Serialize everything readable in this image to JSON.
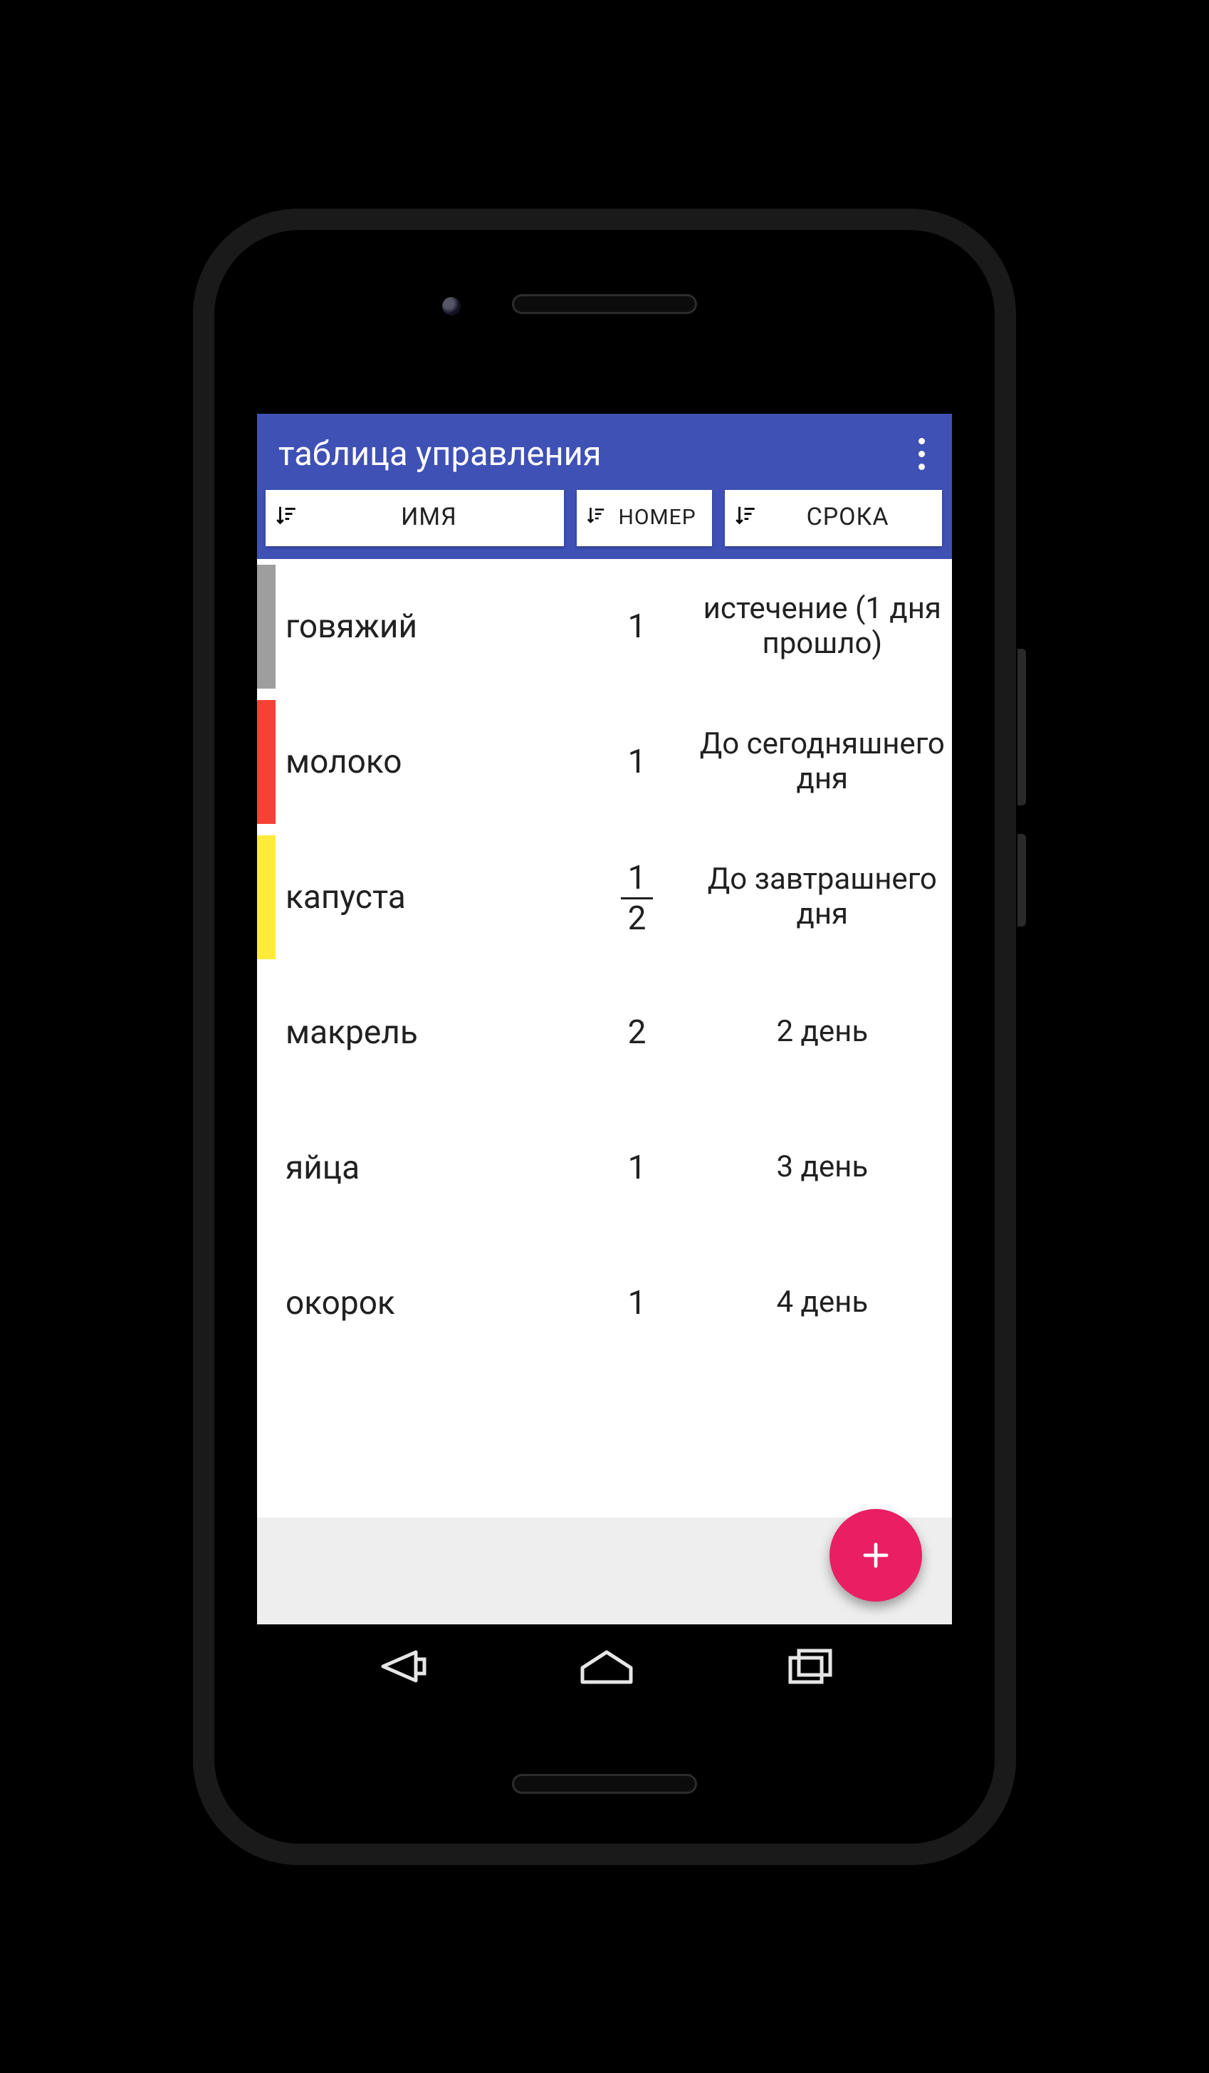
{
  "app_bar": {
    "title": "таблица управления"
  },
  "sort": {
    "name": "ИМЯ",
    "number": "НОМЕР",
    "expiry": "СРОКА"
  },
  "status_colors": {
    "expired": "#9e9e9e",
    "today": "#f44336",
    "tomorrow": "#ffeb3b"
  },
  "rows": [
    {
      "marker": "gray",
      "name": "говяжий",
      "qty": "1",
      "expiry": "истечение (1 дня прошло)"
    },
    {
      "marker": "red",
      "name": "молоко",
      "qty": "1",
      "expiry": "До сегодняшнего дня"
    },
    {
      "marker": "yellow",
      "name": "капуста",
      "qty_num": "1",
      "qty_den": "2",
      "expiry": "До завтрашнего дня"
    },
    {
      "marker": "none",
      "name": "макрель",
      "qty": "2",
      "expiry": "2 день"
    },
    {
      "marker": "none",
      "name": "яйца",
      "qty": "1",
      "expiry": "3 день"
    },
    {
      "marker": "none",
      "name": "окорок",
      "qty": "1",
      "expiry": "4 день"
    }
  ],
  "fab": {
    "label": "+"
  },
  "accent": "#3f51b5",
  "fab_color": "#e91e63"
}
